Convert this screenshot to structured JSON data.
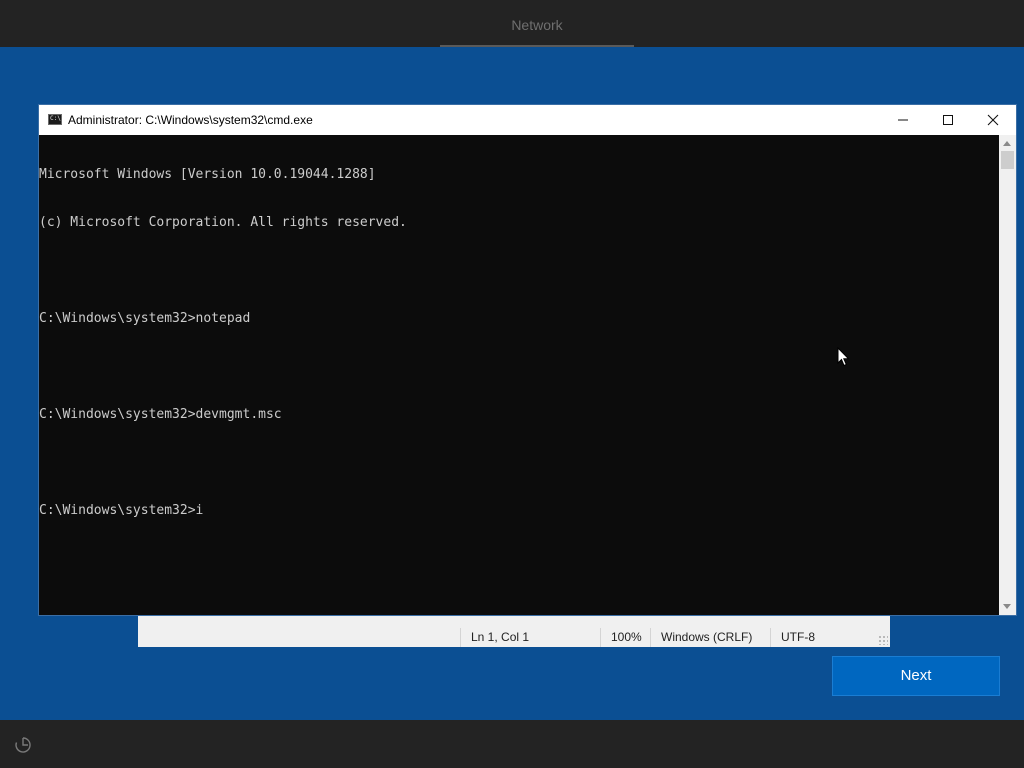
{
  "oobe": {
    "top_tab": "Network",
    "next_label": "Next",
    "accessibility_icon": "ease-of-access-icon"
  },
  "cmd_window": {
    "title": "Administrator: C:\\Windows\\system32\\cmd.exe",
    "app_icon": "console-icon",
    "app_icon_text": "C:\\",
    "controls": [
      "minimize-icon",
      "maximize-icon",
      "close-icon"
    ],
    "console_lines": [
      "Microsoft Windows [Version 10.0.19044.1288]",
      "(c) Microsoft Corporation. All rights reserved.",
      "",
      "C:\\Windows\\system32>notepad",
      "",
      "C:\\Windows\\system32>devmgmt.msc",
      "",
      "C:\\Windows\\system32>i"
    ]
  },
  "notepad_status": {
    "position": "Ln 1, Col 1",
    "zoom": "100%",
    "line_endings": "Windows (CRLF)",
    "encoding": "UTF-8"
  },
  "colors": {
    "background": "#0b4f93",
    "accent_button": "#0067c0",
    "bars": "#232323",
    "console_bg": "#0c0c0c",
    "console_text": "#cccccc"
  }
}
